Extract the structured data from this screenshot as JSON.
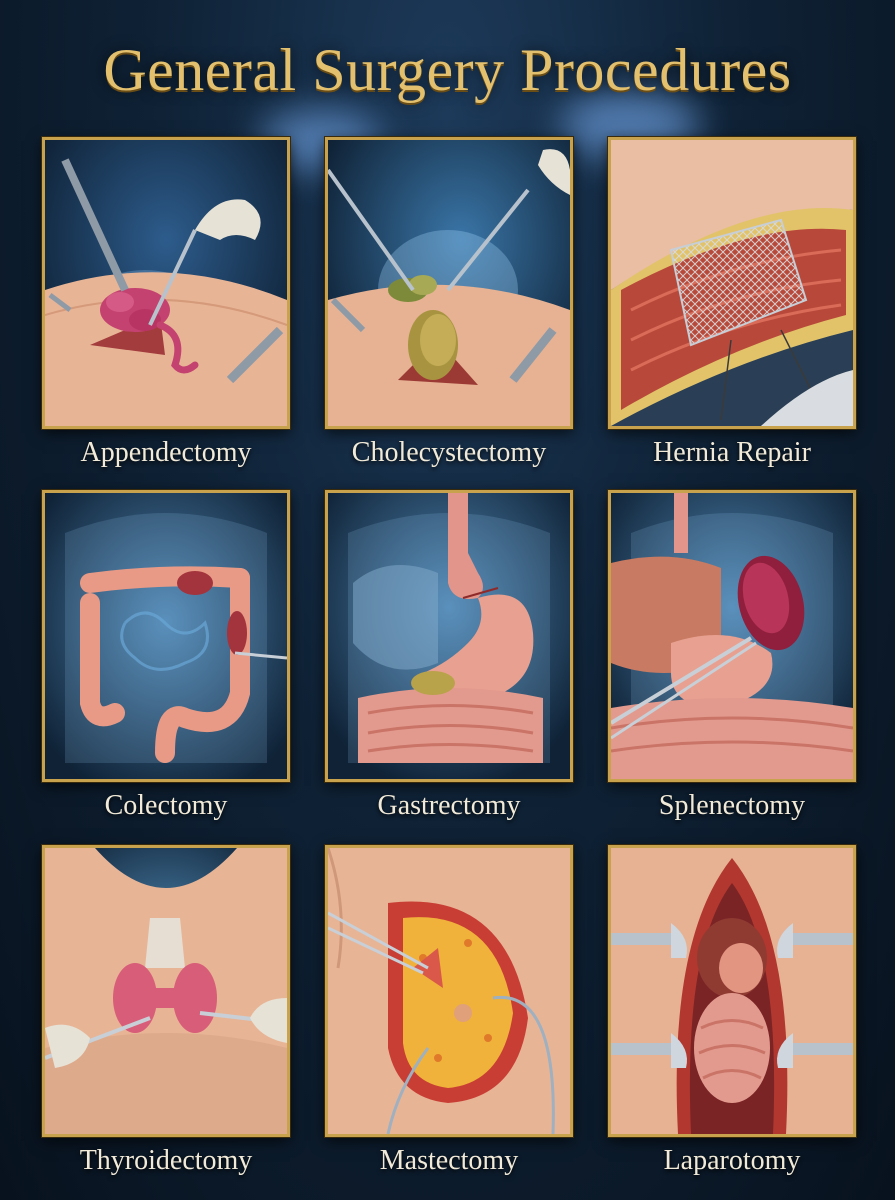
{
  "title": "General Surgery Procedures",
  "procedures": [
    {
      "label": "Appendectomy",
      "icon": "appendix-laparoscopy-icon"
    },
    {
      "label": "Cholecystectomy",
      "icon": "gallbladder-laparoscopy-icon"
    },
    {
      "label": "Hernia Repair",
      "icon": "hernia-mesh-icon"
    },
    {
      "label": "Colectomy",
      "icon": "colon-resection-icon"
    },
    {
      "label": "Gastrectomy",
      "icon": "stomach-resection-icon"
    },
    {
      "label": "Splenectomy",
      "icon": "spleen-removal-icon"
    },
    {
      "label": "Thyroidectomy",
      "icon": "thyroid-removal-icon"
    },
    {
      "label": "Mastectomy",
      "icon": "breast-surgery-icon"
    },
    {
      "label": "Laparotomy",
      "icon": "open-abdomen-icon"
    }
  ],
  "colors": {
    "gold": "#c9a24e",
    "title": "#e3c06e",
    "label": "#f1ead8",
    "background": "#0f2236"
  }
}
